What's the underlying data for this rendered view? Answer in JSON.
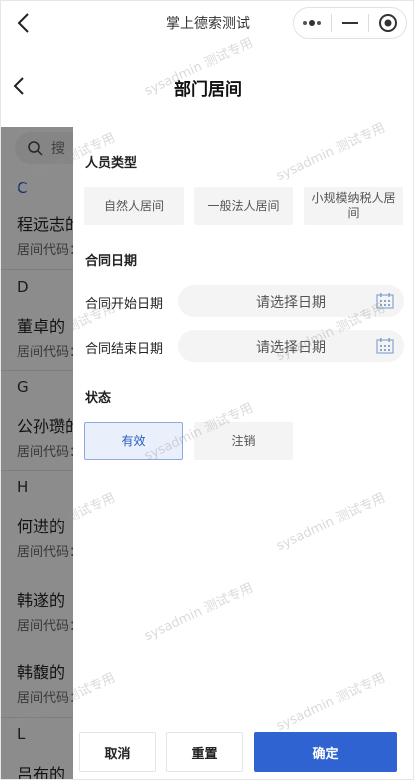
{
  "miniprogram": {
    "title": "掌上德索测试"
  },
  "header": {
    "title": "部门居间"
  },
  "search": {
    "placeholder": "搜"
  },
  "list": {
    "groups": [
      {
        "letter": "C",
        "items": [
          {
            "name": "程远志的",
            "code": "居间代码："
          }
        ]
      },
      {
        "letter": "D",
        "items": [
          {
            "name": "董卓的",
            "code": "居间代码："
          }
        ]
      },
      {
        "letter": "G",
        "items": [
          {
            "name": "公孙瓒的",
            "code": "居间代码："
          }
        ]
      },
      {
        "letter": "H",
        "items": [
          {
            "name": "何进的",
            "code": "居间代码："
          },
          {
            "name": "韩遂的",
            "code": "居间代码："
          },
          {
            "name": "韩馥的",
            "code": "居间代码："
          }
        ]
      },
      {
        "letter": "L",
        "items": [
          {
            "name": "吕布的"
          }
        ]
      }
    ]
  },
  "filter": {
    "person_type": {
      "title": "人员类型",
      "options": [
        "自然人居间",
        "一般法人居间",
        "小规模纳税人居间"
      ]
    },
    "contract_date": {
      "title": "合同日期",
      "start_label": "合同开始日期",
      "end_label": "合同结束日期",
      "placeholder": "请选择日期"
    },
    "status": {
      "title": "状态",
      "options": [
        "有效",
        "注销"
      ],
      "selected": "有效"
    },
    "buttons": {
      "cancel": "取消",
      "reset": "重置",
      "confirm": "确定"
    }
  },
  "watermark": {
    "text": "sysadmin 测试专用"
  },
  "colors": {
    "primary": "#2f63d1",
    "selected_bg": "#e9f0fb",
    "index_letter": "#1f56c6"
  }
}
